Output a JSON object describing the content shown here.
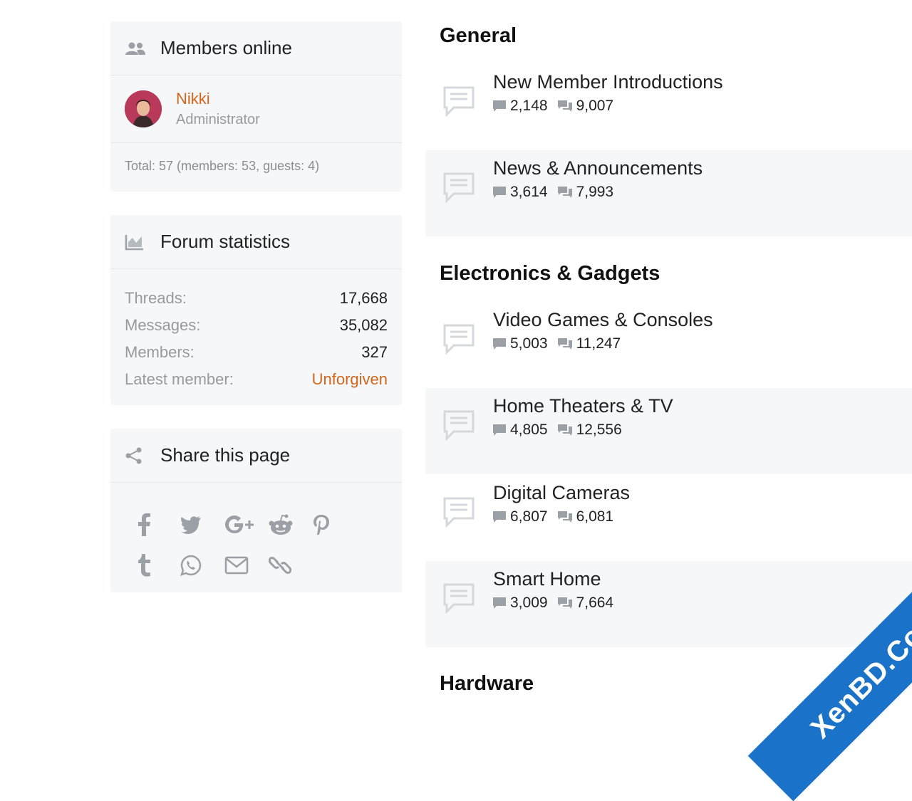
{
  "sidebar": {
    "members_online": {
      "title": "Members online",
      "member": {
        "name": "Nikki",
        "role": "Administrator"
      },
      "total": "Total: 57 (members: 53, guests: 4)"
    },
    "forum_statistics": {
      "title": "Forum statistics",
      "rows": [
        {
          "label": "Threads:",
          "value": "17,668"
        },
        {
          "label": "Messages:",
          "value": "35,082"
        },
        {
          "label": "Members:",
          "value": "327"
        },
        {
          "label": "Latest member:",
          "value": "Unforgiven"
        }
      ]
    },
    "share": {
      "title": "Share this page",
      "icons": [
        "facebook-icon",
        "twitter-icon",
        "google-plus-icon",
        "reddit-icon",
        "pinterest-icon",
        "tumblr-icon",
        "whatsapp-icon",
        "email-icon",
        "link-icon"
      ]
    }
  },
  "main": {
    "categories": [
      {
        "title": "General",
        "nodes": [
          {
            "title": "New Member Introductions",
            "threads": "2,148",
            "messages": "9,007"
          },
          {
            "title": "News & Announcements",
            "threads": "3,614",
            "messages": "7,993"
          }
        ]
      },
      {
        "title": "Electronics & Gadgets",
        "nodes": [
          {
            "title": "Video Games & Consoles",
            "threads": "5,003",
            "messages": "11,247"
          },
          {
            "title": "Home Theaters & TV",
            "threads": "4,805",
            "messages": "12,556"
          },
          {
            "title": "Digital Cameras",
            "threads": "6,807",
            "messages": "6,081"
          },
          {
            "title": "Smart Home",
            "threads": "3,009",
            "messages": "7,664"
          }
        ]
      },
      {
        "title": "Hardware",
        "nodes": []
      }
    ]
  },
  "watermark": {
    "text": "XenBD.Com"
  },
  "colors": {
    "accent": "#d4661c",
    "block_bg": "#f6f7f8",
    "watermark": "#1a73c8"
  }
}
